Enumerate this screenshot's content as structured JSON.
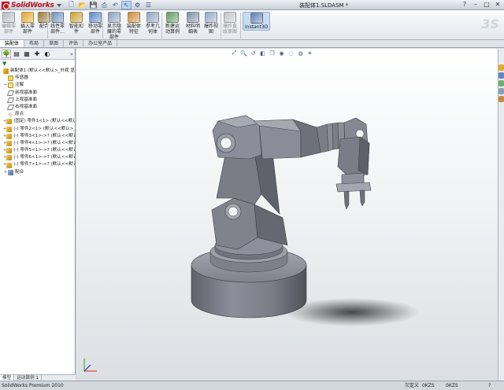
{
  "titlebar": {
    "app_name": "SolidWorks",
    "document_title": "装配体1.SLDASM *",
    "quick_access": [
      {
        "icon": "new-document-icon",
        "glyph": "🗋"
      },
      {
        "icon": "open-folder-icon",
        "glyph": "📂"
      },
      {
        "icon": "save-icon",
        "glyph": "💾"
      },
      {
        "icon": "print-icon",
        "glyph": "⎙"
      },
      {
        "icon": "undo-icon",
        "glyph": "↶"
      },
      {
        "icon": "select-arrow-icon",
        "glyph": "↖"
      },
      {
        "icon": "rebuild-icon",
        "glyph": "⚙"
      },
      {
        "icon": "options-icon",
        "glyph": "☰"
      }
    ],
    "window_controls": [
      "?",
      "–",
      "□",
      "✕"
    ]
  },
  "command_manager": {
    "buttons": [
      {
        "id": "edit-component",
        "label": "编辑零\n部件",
        "disabled": true,
        "color": "#b8bcc4"
      },
      {
        "id": "insert-components",
        "label": "插入零\n部件",
        "disabled": false,
        "color": "#e3a52a"
      },
      {
        "id": "mate",
        "label": "配合",
        "disabled": false,
        "color": "#9a7b3c"
      },
      {
        "id": "linear-pattern",
        "label": "线性零\n部件...",
        "disabled": false,
        "color": "#6f8fb8"
      },
      {
        "id": "smart-fasteners",
        "label": "智能扣\n件",
        "disabled": false,
        "color": "#c9a030"
      },
      {
        "id": "move-component",
        "label": "移动零\n部件",
        "disabled": false,
        "color": "#5c88c6"
      },
      {
        "id": "show-hidden",
        "label": "显示隐\n藏的零\n部件",
        "disabled": false,
        "color": "#8a9fbd"
      },
      {
        "id": "assembly-features",
        "label": "装配体\n特征",
        "disabled": false,
        "color": "#c98a3a"
      },
      {
        "id": "reference-geometry",
        "label": "参考几\n何体",
        "disabled": false,
        "color": "#8ca3c2"
      },
      {
        "id": "new-motion-study",
        "label": "新建运\n动算例",
        "disabled": false,
        "color": "#5e9a5e"
      },
      {
        "id": "bill-of-materials",
        "label": "材料明\n细表",
        "disabled": false,
        "color": "#7a8fa8"
      },
      {
        "id": "exploded-view",
        "label": "爆炸视\n图",
        "disabled": false,
        "color": "#8fa9c8"
      },
      {
        "id": "explode-line-sketch",
        "label": "爆炸直\n线草图",
        "disabled": true,
        "color": "#c0c4ca"
      },
      {
        "id": "instant3d",
        "label": "Instant3D",
        "disabled": false,
        "active": true,
        "color": "#5d7fae"
      }
    ]
  },
  "tabs": [
    {
      "label": "装配体",
      "active": true
    },
    {
      "label": "布局",
      "active": false
    },
    {
      "label": "草图",
      "active": false
    },
    {
      "label": "评估",
      "active": false
    },
    {
      "label": "办公室产品",
      "active": false
    }
  ],
  "feature_tree": {
    "panel_tabs": [
      {
        "icon": "feature-manager-icon",
        "glyph": "🌳",
        "active": true
      },
      {
        "icon": "property-manager-icon",
        "glyph": "▤",
        "active": false
      },
      {
        "icon": "configuration-manager-icon",
        "glyph": "▦",
        "active": false
      },
      {
        "icon": "dimxpert-icon",
        "glyph": "✚",
        "active": false
      },
      {
        "icon": "display-manager-icon",
        "glyph": "◐",
        "active": false
      }
    ],
    "items": [
      {
        "text": "装配体1 (默认<<默认>_外观 显",
        "icon": "asm",
        "expander": "",
        "indent": 0
      },
      {
        "text": "传感器",
        "icon": "sensor",
        "expander": "",
        "indent": 1
      },
      {
        "text": "注解",
        "icon": "note",
        "expander": "+",
        "indent": 1
      },
      {
        "text": "前视基准面",
        "icon": "plane",
        "expander": "",
        "indent": 1
      },
      {
        "text": "上视基准面",
        "icon": "plane",
        "expander": "",
        "indent": 1
      },
      {
        "text": "右视基准面",
        "icon": "plane",
        "expander": "",
        "indent": 1
      },
      {
        "text": "原点",
        "icon": "origin",
        "expander": "",
        "indent": 1
      },
      {
        "text": "(固定) 零件1<1> (默认<<默认",
        "icon": "part",
        "expander": "+",
        "indent": 1
      },
      {
        "text": "(-) 零件2<1> (默认<<默认>_",
        "icon": "part",
        "expander": "+",
        "indent": 1
      },
      {
        "text": "(-) 零件3<1>->? (默认<<默认",
        "icon": "part",
        "expander": "+",
        "indent": 1
      },
      {
        "text": "(-) 零件4<1>->? (默认<<默认",
        "icon": "part",
        "expander": "+",
        "indent": 1
      },
      {
        "text": "(-) 零件5<1>->? (默认<<默认",
        "icon": "part",
        "expander": "+",
        "indent": 1
      },
      {
        "text": "(-) 零件6<1>->? (默认<<默认",
        "icon": "part",
        "expander": "+",
        "indent": 1
      },
      {
        "text": "(-) 零件7<1>->? (默认<<默认",
        "icon": "part",
        "expander": "+",
        "indent": 1
      },
      {
        "text": "配合",
        "icon": "mate",
        "expander": "+",
        "indent": 1
      }
    ]
  },
  "bottom_tabs": [
    {
      "label": "模型",
      "active": true
    },
    {
      "label": "运动算例 1",
      "active": false
    }
  ],
  "heads_up": [
    {
      "icon": "zoom-to-fit-icon",
      "glyph": "⤢"
    },
    {
      "icon": "zoom-area-icon",
      "glyph": "🔍"
    },
    {
      "icon": "previous-view-icon",
      "glyph": "↺"
    },
    {
      "icon": "section-view-icon",
      "glyph": "◧"
    },
    {
      "icon": "view-orientation-icon",
      "glyph": "❒"
    },
    {
      "icon": "display-style-icon",
      "glyph": "◉"
    },
    {
      "icon": "hide-show-icon",
      "glyph": "◌"
    },
    {
      "icon": "edit-appearance-icon",
      "glyph": "◍"
    },
    {
      "icon": "scene-icon",
      "glyph": "☀"
    }
  ],
  "statusbar": {
    "app_version": "SolidWorks Premium 2010",
    "state": "欠定义",
    "units1": "0KZS",
    "units2": "0KZS",
    "help": "?"
  },
  "colors": {
    "model_fill": "#7c7f89",
    "model_light": "#9a9da7",
    "model_dark": "#55585f",
    "accent": "#c8161d"
  }
}
